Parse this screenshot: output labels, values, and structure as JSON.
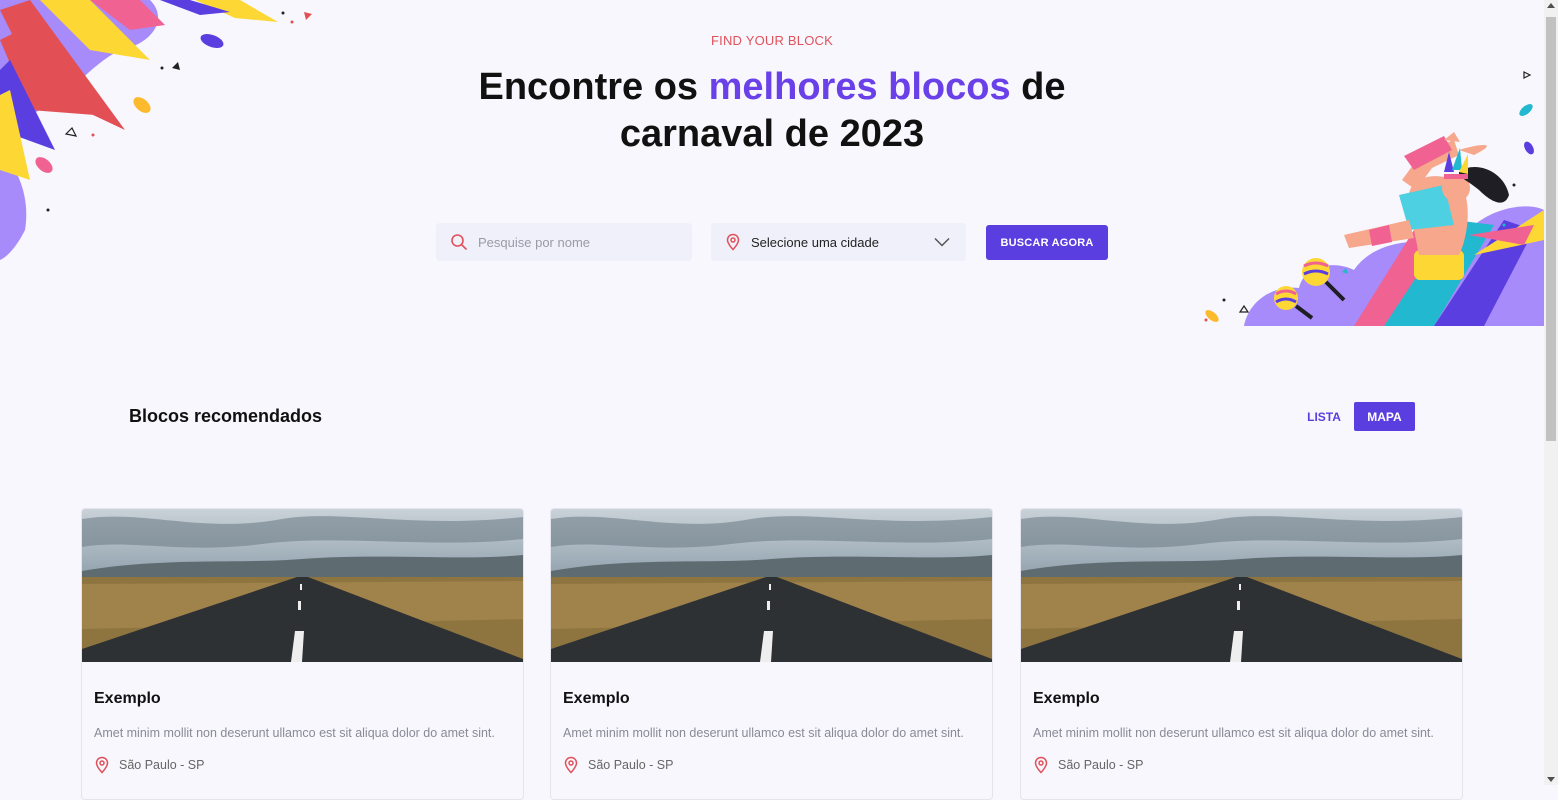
{
  "hero": {
    "eyebrow": "FIND YOUR BLOCK",
    "title_part1": "Encontre os ",
    "title_accent": "melhores blocos",
    "title_part2": " de",
    "title_line2": "carnaval de 2023"
  },
  "search": {
    "placeholder": "Pesquise por nome",
    "icon": "search-icon"
  },
  "city_select": {
    "selected": "Selecione uma cidade",
    "icon": "map-pin-icon"
  },
  "buttons": {
    "search_now": "BUSCAR AGORA"
  },
  "recommended": {
    "title": "Blocos recomendados",
    "view_list": "LISTA",
    "view_map": "MAPA"
  },
  "cards": [
    {
      "title": "Exemplo",
      "description": "Amet minim mollit non deserunt ullamco est sit aliqua dolor do amet sint.",
      "location": "São Paulo - SP"
    },
    {
      "title": "Exemplo",
      "description": "Amet minim mollit non deserunt ullamco est sit aliqua dolor do amet sint.",
      "location": "São Paulo - SP"
    },
    {
      "title": "Exemplo",
      "description": "Amet minim mollit non deserunt ullamco est sit aliqua dolor do amet sint.",
      "location": "São Paulo - SP"
    }
  ],
  "colors": {
    "accent": "#5B3EE0",
    "title_accent": "#6A40E8",
    "eyebrow": "#E0525B",
    "background": "#F7F7FD"
  }
}
